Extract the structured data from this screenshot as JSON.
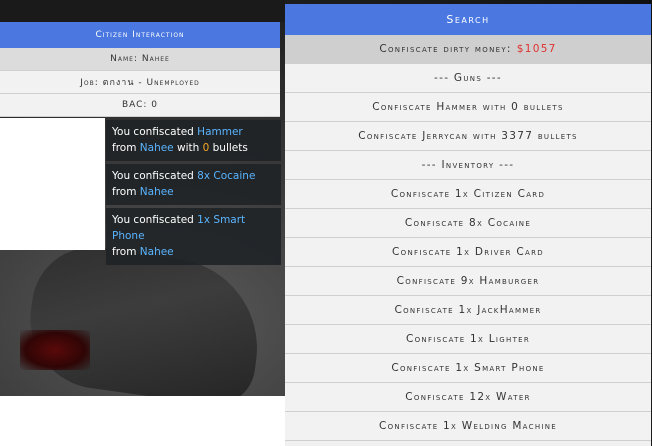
{
  "citizen_menu": {
    "title": "Citizen Interaction",
    "name": "Name: Nahee",
    "job": "Job: ตกงาน - Unemployed",
    "bac": "BAC: 0"
  },
  "notifications": [
    {
      "p1": "You confiscated ",
      "item": "Hammer",
      "p2": " from ",
      "target": "Nahee",
      "p3": " with ",
      "count": "0",
      "p4": " bullets"
    },
    {
      "p1": "You confiscated ",
      "item": "8x Cocaine",
      "p2": " from ",
      "target": "Nahee"
    },
    {
      "p1": "You confiscated ",
      "item": "1x Smart Phone",
      "p2": " from ",
      "target": "Nahee"
    }
  ],
  "search_menu": {
    "title": "Search",
    "money_label": "Confiscate dirty money:",
    "money_value": "$1057",
    "items": [
      "--- Guns ---",
      "Confiscate Hammer with 0 bullets",
      "Confiscate Jerrycan with 3377 bullets",
      "--- Inventory ---",
      "Confiscate 1x Citizen Card",
      "Confiscate 8x Cocaine",
      "Confiscate 1x Driver Card",
      "Confiscate 9x Hamburger",
      "Confiscate 1x JackHammer",
      "Confiscate 1x Lighter",
      "Confiscate 1x Smart Phone",
      "Confiscate 12x Water",
      "Confiscate 1x Welding Machine"
    ]
  },
  "colors": {
    "header_blue": "#4a78e0",
    "money_red": "#e03030",
    "highlight_blue": "#5ab4ff",
    "highlight_orange": "#f5a623"
  }
}
